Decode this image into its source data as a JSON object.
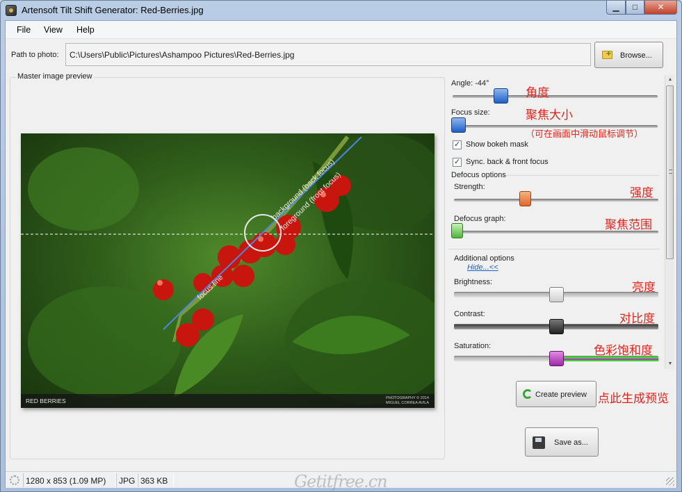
{
  "window": {
    "title": "Artensoft Tilt Shift Generator: Red-Berries.jpg",
    "min": "▁",
    "max": "□",
    "close": "✕"
  },
  "menu": {
    "file": "File",
    "view": "View",
    "help": "Help"
  },
  "path": {
    "label": "Path to photo:",
    "value": "C:\\Users\\Public\\Pictures\\Ashampoo Pictures\\Red-Berries.jpg",
    "browse": "Browse..."
  },
  "preview": {
    "group_label": "Master image preview",
    "caption": "RED BERRIES",
    "credit_line1": "PHOTOGRAPHY © 2014",
    "credit_line2": "MIGUEL CORREA AVILA",
    "overlay": {
      "background": "background (back focus)",
      "foreground": "foreground (front focus)",
      "line": "focus line"
    }
  },
  "controls": {
    "angle_label": "Angle: -44°",
    "angle_value": -44,
    "focus_size_label": "Focus size:",
    "show_bokeh": "Show bokeh mask",
    "sync_focus": "Sync. back & front focus",
    "defocus_options": "Defocus options",
    "strength_label": "Strength:",
    "defocus_graph_label": "Defocus graph:",
    "additional_options": "Additional options",
    "hide_link": "Hide...<<",
    "brightness_label": "Brightness:",
    "contrast_label": "Contrast:",
    "saturation_label": "Saturation:"
  },
  "annotations": {
    "angle": "角度",
    "focus_size": "聚焦大小",
    "focus_size_note": "（可在画面中滑动鼠标调节）",
    "strength": "强度",
    "defocus_graph": "聚焦范围",
    "brightness": "亮度",
    "contrast": "对比度",
    "saturation": "色彩饱和度",
    "create_preview": "点此生成预览"
  },
  "buttons": {
    "create_preview": "Create preview",
    "save_as": "Save as..."
  },
  "status": {
    "dimensions": "1280 x 853 (1.09 MP)",
    "format": "JPG",
    "size": "363 KB",
    "watermark": "Getitfree.cn"
  },
  "colors": {
    "accent_blue": "#1f5fc6",
    "annotation_red": "#e0231b",
    "berry_red": "#c8150e",
    "saturation_green": "#44d23a",
    "saturation_purple": "#b03cbd"
  }
}
